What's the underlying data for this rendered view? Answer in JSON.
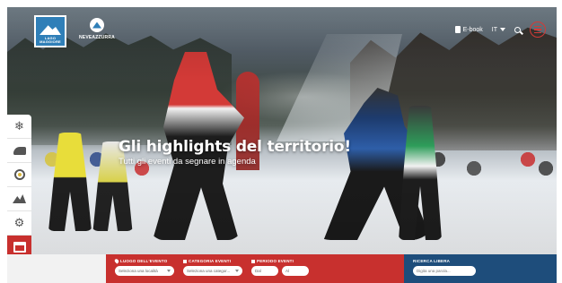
{
  "header": {
    "logo_laghi": {
      "line1": "LAGO",
      "line2": "MAGGIORE"
    },
    "logo_neve": {
      "title": "NEVEAZZURRA"
    },
    "ebook_label": "E-book",
    "lang_label": "IT",
    "icons": {
      "ebook": "book-icon",
      "search": "search-icon",
      "menu": "hamburger-menu-icon",
      "lang": "chevron-down-icon"
    }
  },
  "hero": {
    "title": "Gli highlights del territorio!",
    "subtitle": "Tutti gli eventi da segnare in agenda"
  },
  "sidebar": {
    "items": [
      {
        "icon": "snowflake-icon",
        "glyph": "❄"
      },
      {
        "icon": "snowshoe-icon"
      },
      {
        "icon": "badge-icon"
      },
      {
        "icon": "mountain-icon"
      },
      {
        "icon": "gear-icon",
        "glyph": "⚙"
      },
      {
        "icon": "calendar-icon",
        "active": true
      },
      {
        "icon": "bed-icon"
      }
    ]
  },
  "search": {
    "location": {
      "label": "LUOGO DELL'EVENTO",
      "placeholder": "Seleziona una località"
    },
    "category": {
      "label": "CATEGORIA EVENTI",
      "placeholder": "Seleziona una categor..."
    },
    "period": {
      "label": "PERIODO EVENTI",
      "from": "Dal",
      "to": "Al"
    },
    "free": {
      "label": "RICERCA LIBERA",
      "placeholder": "Digita una parola..."
    }
  },
  "colors": {
    "accent_red": "#c8302e",
    "accent_blue": "#1e4d7b",
    "brand_blue": "#2f7fb8"
  }
}
